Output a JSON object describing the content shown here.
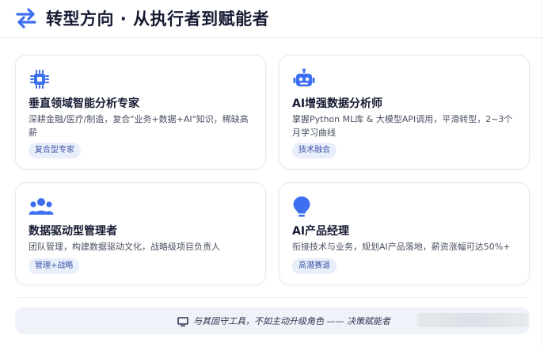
{
  "header": {
    "icon": "swap-arrows-icon",
    "title": "转型方向 · 从执行者到赋能者",
    "accent": "#3d6ff0"
  },
  "cards": [
    {
      "icon": "chip-icon",
      "title": "垂直领域智能分析专家",
      "desc": "深耕金融/医疗/制造，复合\"业务+数据+AI\"知识，稀缺高薪",
      "tag": "复合型专家"
    },
    {
      "icon": "robot-icon",
      "title": "AI增强数据分析师",
      "desc": "掌握Python ML库 & 大模型API调用，平滑转型，2~3个月学习曲线",
      "tag": "技术融合"
    },
    {
      "icon": "users-icon",
      "title": "数据驱动型管理者",
      "desc": "团队管理，构建数据驱动文化，战略级项目负责人",
      "tag": "管理+战略"
    },
    {
      "icon": "lightbulb-icon",
      "title": "AI产品经理",
      "desc": "衔接技术与业务，规划AI产品落地，薪资涨幅可达50%+",
      "tag": "高潜赛道"
    }
  ],
  "footer": {
    "icon": "monitor-icon",
    "quote": "与其固守工具，不如主动升级角色 —— 决策赋能者"
  },
  "colors": {
    "icon_blue": "#3d6ff0",
    "tag_bg": "#e9eefb",
    "tag_text": "#3d56a8",
    "footer_bg": "#eff2f8"
  }
}
